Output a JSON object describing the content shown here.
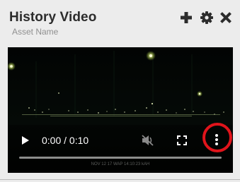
{
  "header": {
    "title": "History Video",
    "subtitle": "Asset Name"
  },
  "toolbar": {
    "icons": [
      "plus-icon",
      "gear-icon",
      "close-icon"
    ]
  },
  "player": {
    "time_display": "0:00 / 0:10",
    "progress_fraction": 0,
    "caption": "NOV 12 17 WAP 14:10:23 kAH",
    "icons": [
      "play-icon",
      "volume-muted-icon",
      "fullscreen-icon",
      "more-options-icon"
    ]
  },
  "colors": {
    "highlight": "#e0141b",
    "video_background": "#030605"
  }
}
